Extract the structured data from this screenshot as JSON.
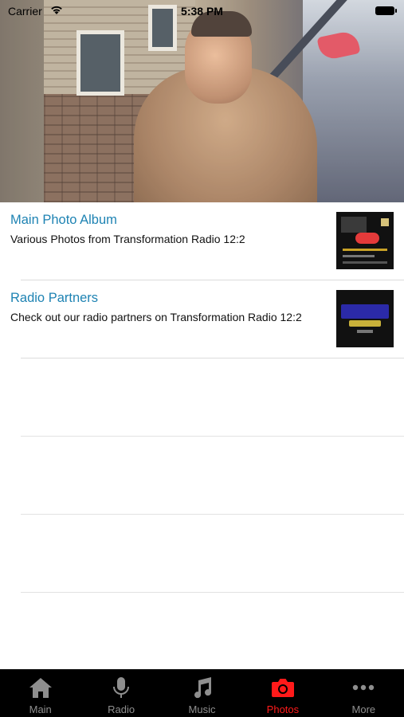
{
  "status_bar": {
    "carrier": "Carrier",
    "time": "5:38 PM"
  },
  "header": {
    "image": "header-photo-man-on-porch"
  },
  "albums": [
    {
      "title": "Main Photo Album",
      "subtitle": "Various Photos from Transformation Radio 12:2",
      "thumbnail": "album-flyer-thumbnail"
    },
    {
      "title": "Radio Partners",
      "subtitle": "Check out our radio partners on Transformation Radio 12:2",
      "thumbnail": "kingdom-crunk-radio-logo"
    }
  ],
  "tabs": [
    {
      "label": "Main",
      "icon": "home-icon",
      "active": false
    },
    {
      "label": "Radio",
      "icon": "microphone-icon",
      "active": false
    },
    {
      "label": "Music",
      "icon": "music-note-icon",
      "active": false
    },
    {
      "label": "Photos",
      "icon": "camera-icon",
      "active": true
    },
    {
      "label": "More",
      "icon": "more-dots-icon",
      "active": false
    }
  ],
  "colors": {
    "title_blue": "#1e83b3",
    "tab_active": "#ff1a1a",
    "tab_inactive": "#8e8e8e",
    "tabbar_bg": "#000000"
  }
}
